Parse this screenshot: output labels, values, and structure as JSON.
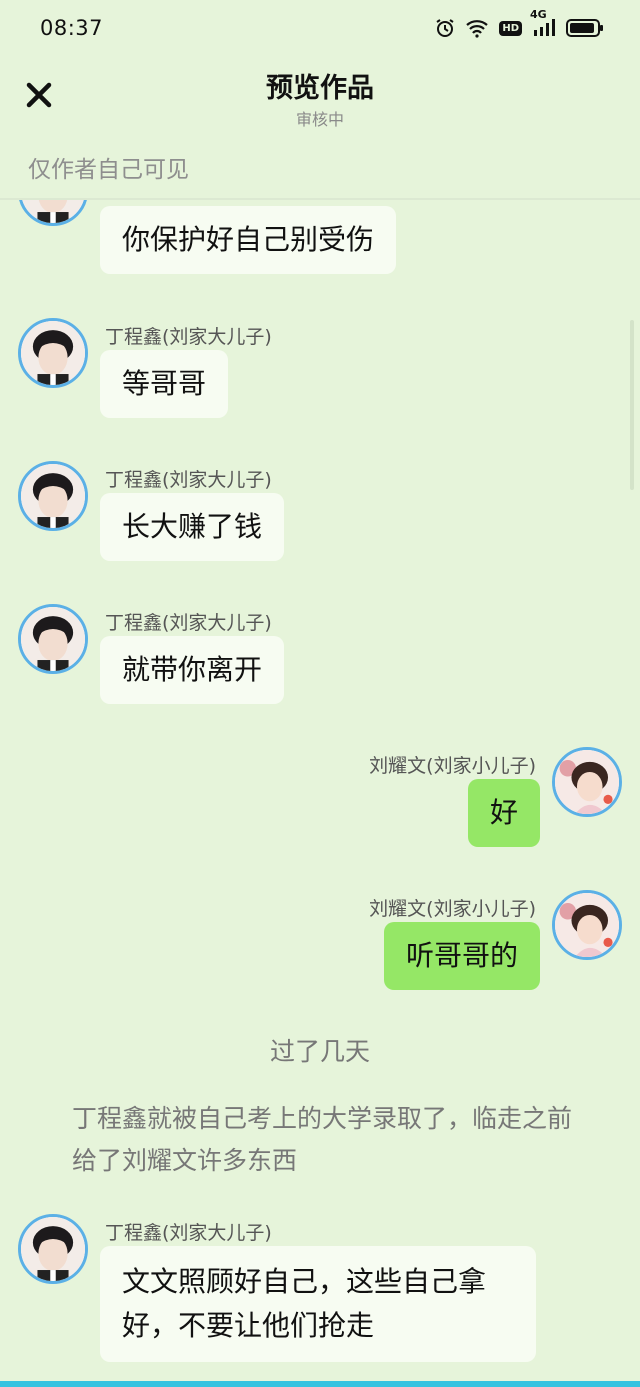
{
  "status": {
    "time": "08:37",
    "hd_label": "HD",
    "network_label": "4G"
  },
  "header": {
    "title": "预览作品",
    "subtitle": "审核中"
  },
  "visibility_note": "仅作者自己可见",
  "messages": [
    {
      "side": "left",
      "sender": "",
      "text": "你保护好自己别受伤"
    },
    {
      "side": "left",
      "sender": "丁程鑫(刘家大儿子)",
      "text": "等哥哥"
    },
    {
      "side": "left",
      "sender": "丁程鑫(刘家大儿子)",
      "text": "长大赚了钱"
    },
    {
      "side": "left",
      "sender": "丁程鑫(刘家大儿子)",
      "text": "就带你离开"
    },
    {
      "side": "right",
      "sender": "刘耀文(刘家小儿子)",
      "text": "好"
    },
    {
      "side": "right",
      "sender": "刘耀文(刘家小儿子)",
      "text": "听哥哥的"
    },
    {
      "side": "left",
      "sender": "丁程鑫(刘家大儿子)",
      "text": "文文照顾好自己，这些自己拿好，不要让他们抢走"
    }
  ],
  "narration": {
    "time_skip": "过了几天",
    "paragraph": "丁程鑫就被自己考上的大学录取了，临走之前给了刘耀文许多东西"
  },
  "colors": {
    "background": "#e6f4da",
    "bubble_left": "#f7fcf2",
    "bubble_right": "#95e766",
    "avatar_ring": "#5bb0e6"
  }
}
